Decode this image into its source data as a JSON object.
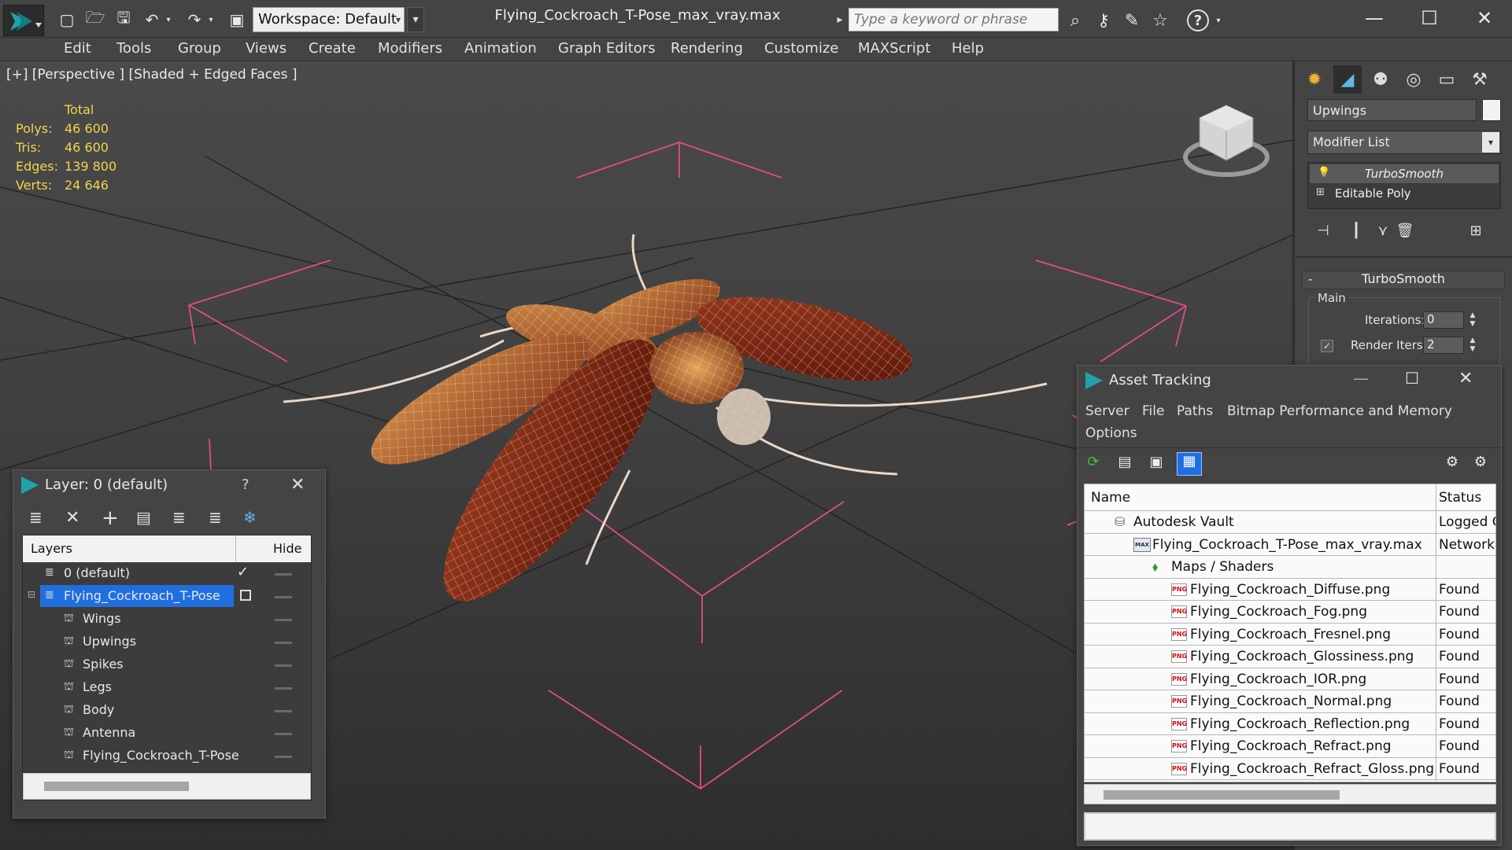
{
  "titlebar": {
    "workspace": "Workspace: Default",
    "document_title": "Flying_Cockroach_T-Pose_max_vray.max",
    "search_placeholder": "Type a keyword or phrase"
  },
  "menu": [
    "Edit",
    "Tools",
    "Group",
    "Views",
    "Create",
    "Modifiers",
    "Animation",
    "Graph Editors",
    "Rendering",
    "Customize",
    "MAXScript",
    "Help"
  ],
  "viewport": {
    "label": "[+] [Perspective ] [Shaded + Edged Faces ]",
    "stats_header": "Total",
    "stats": [
      {
        "label": "Polys:",
        "value": "46 600"
      },
      {
        "label": "Tris:",
        "value": "46 600"
      },
      {
        "label": "Edges:",
        "value": "139 800"
      },
      {
        "label": "Verts:",
        "value": "24 646"
      }
    ]
  },
  "command_panel": {
    "object_name": "Upwings",
    "modifier_list": "Modifier List",
    "stack": [
      "TurboSmooth",
      "Editable Poly"
    ],
    "rollout_title": "TurboSmooth",
    "group_title": "Main",
    "iterations_label": "Iterations:",
    "iterations_value": "0",
    "render_iters_label": "Render Iters:",
    "render_iters_value": "2",
    "accent_color": "#f2d54a"
  },
  "layer_window": {
    "title": "Layer: 0 (default)",
    "help": "?",
    "col_layers": "Layers",
    "col_hide": "Hide",
    "rows": [
      {
        "label": "0 (default)",
        "level": 0
      },
      {
        "label": "Flying_Cockroach_T-Pose",
        "level": 0,
        "selected": true
      },
      {
        "label": "Wings",
        "level": 1
      },
      {
        "label": "Upwings",
        "level": 1
      },
      {
        "label": "Spikes",
        "level": 1
      },
      {
        "label": "Legs",
        "level": 1
      },
      {
        "label": "Body",
        "level": 1
      },
      {
        "label": "Antenna",
        "level": 1
      },
      {
        "label": "Flying_Cockroach_T-Pose",
        "level": 1
      }
    ],
    "selected_color": "#1f6fe0"
  },
  "asset_window": {
    "title": "Asset Tracking",
    "menu": [
      "Server",
      "File",
      "Paths",
      "Bitmap Performance and Memory",
      "Options"
    ],
    "col_name": "Name",
    "col_status": "Status",
    "rows": [
      {
        "name": "Autodesk Vault",
        "status": "Logged O",
        "indent": 1
      },
      {
        "name": "Flying_Cockroach_T-Pose_max_vray.max",
        "status": "Network I",
        "indent": 2
      },
      {
        "name": "Maps / Shaders",
        "status": "",
        "indent": 3
      },
      {
        "name": "Flying_Cockroach_Diffuse.png",
        "status": "Found",
        "indent": 4
      },
      {
        "name": "Flying_Cockroach_Fog.png",
        "status": "Found",
        "indent": 4
      },
      {
        "name": "Flying_Cockroach_Fresnel.png",
        "status": "Found",
        "indent": 4
      },
      {
        "name": "Flying_Cockroach_Glossiness.png",
        "status": "Found",
        "indent": 4
      },
      {
        "name": "Flying_Cockroach_IOR.png",
        "status": "Found",
        "indent": 4
      },
      {
        "name": "Flying_Cockroach_Normal.png",
        "status": "Found",
        "indent": 4
      },
      {
        "name": "Flying_Cockroach_Reflection.png",
        "status": "Found",
        "indent": 4
      },
      {
        "name": "Flying_Cockroach_Refract.png",
        "status": "Found",
        "indent": 4
      },
      {
        "name": "Flying_Cockroach_Refract_Gloss.png",
        "status": "Found",
        "indent": 4
      }
    ],
    "png_badge": "PNG",
    "max_badge": "MAX"
  }
}
